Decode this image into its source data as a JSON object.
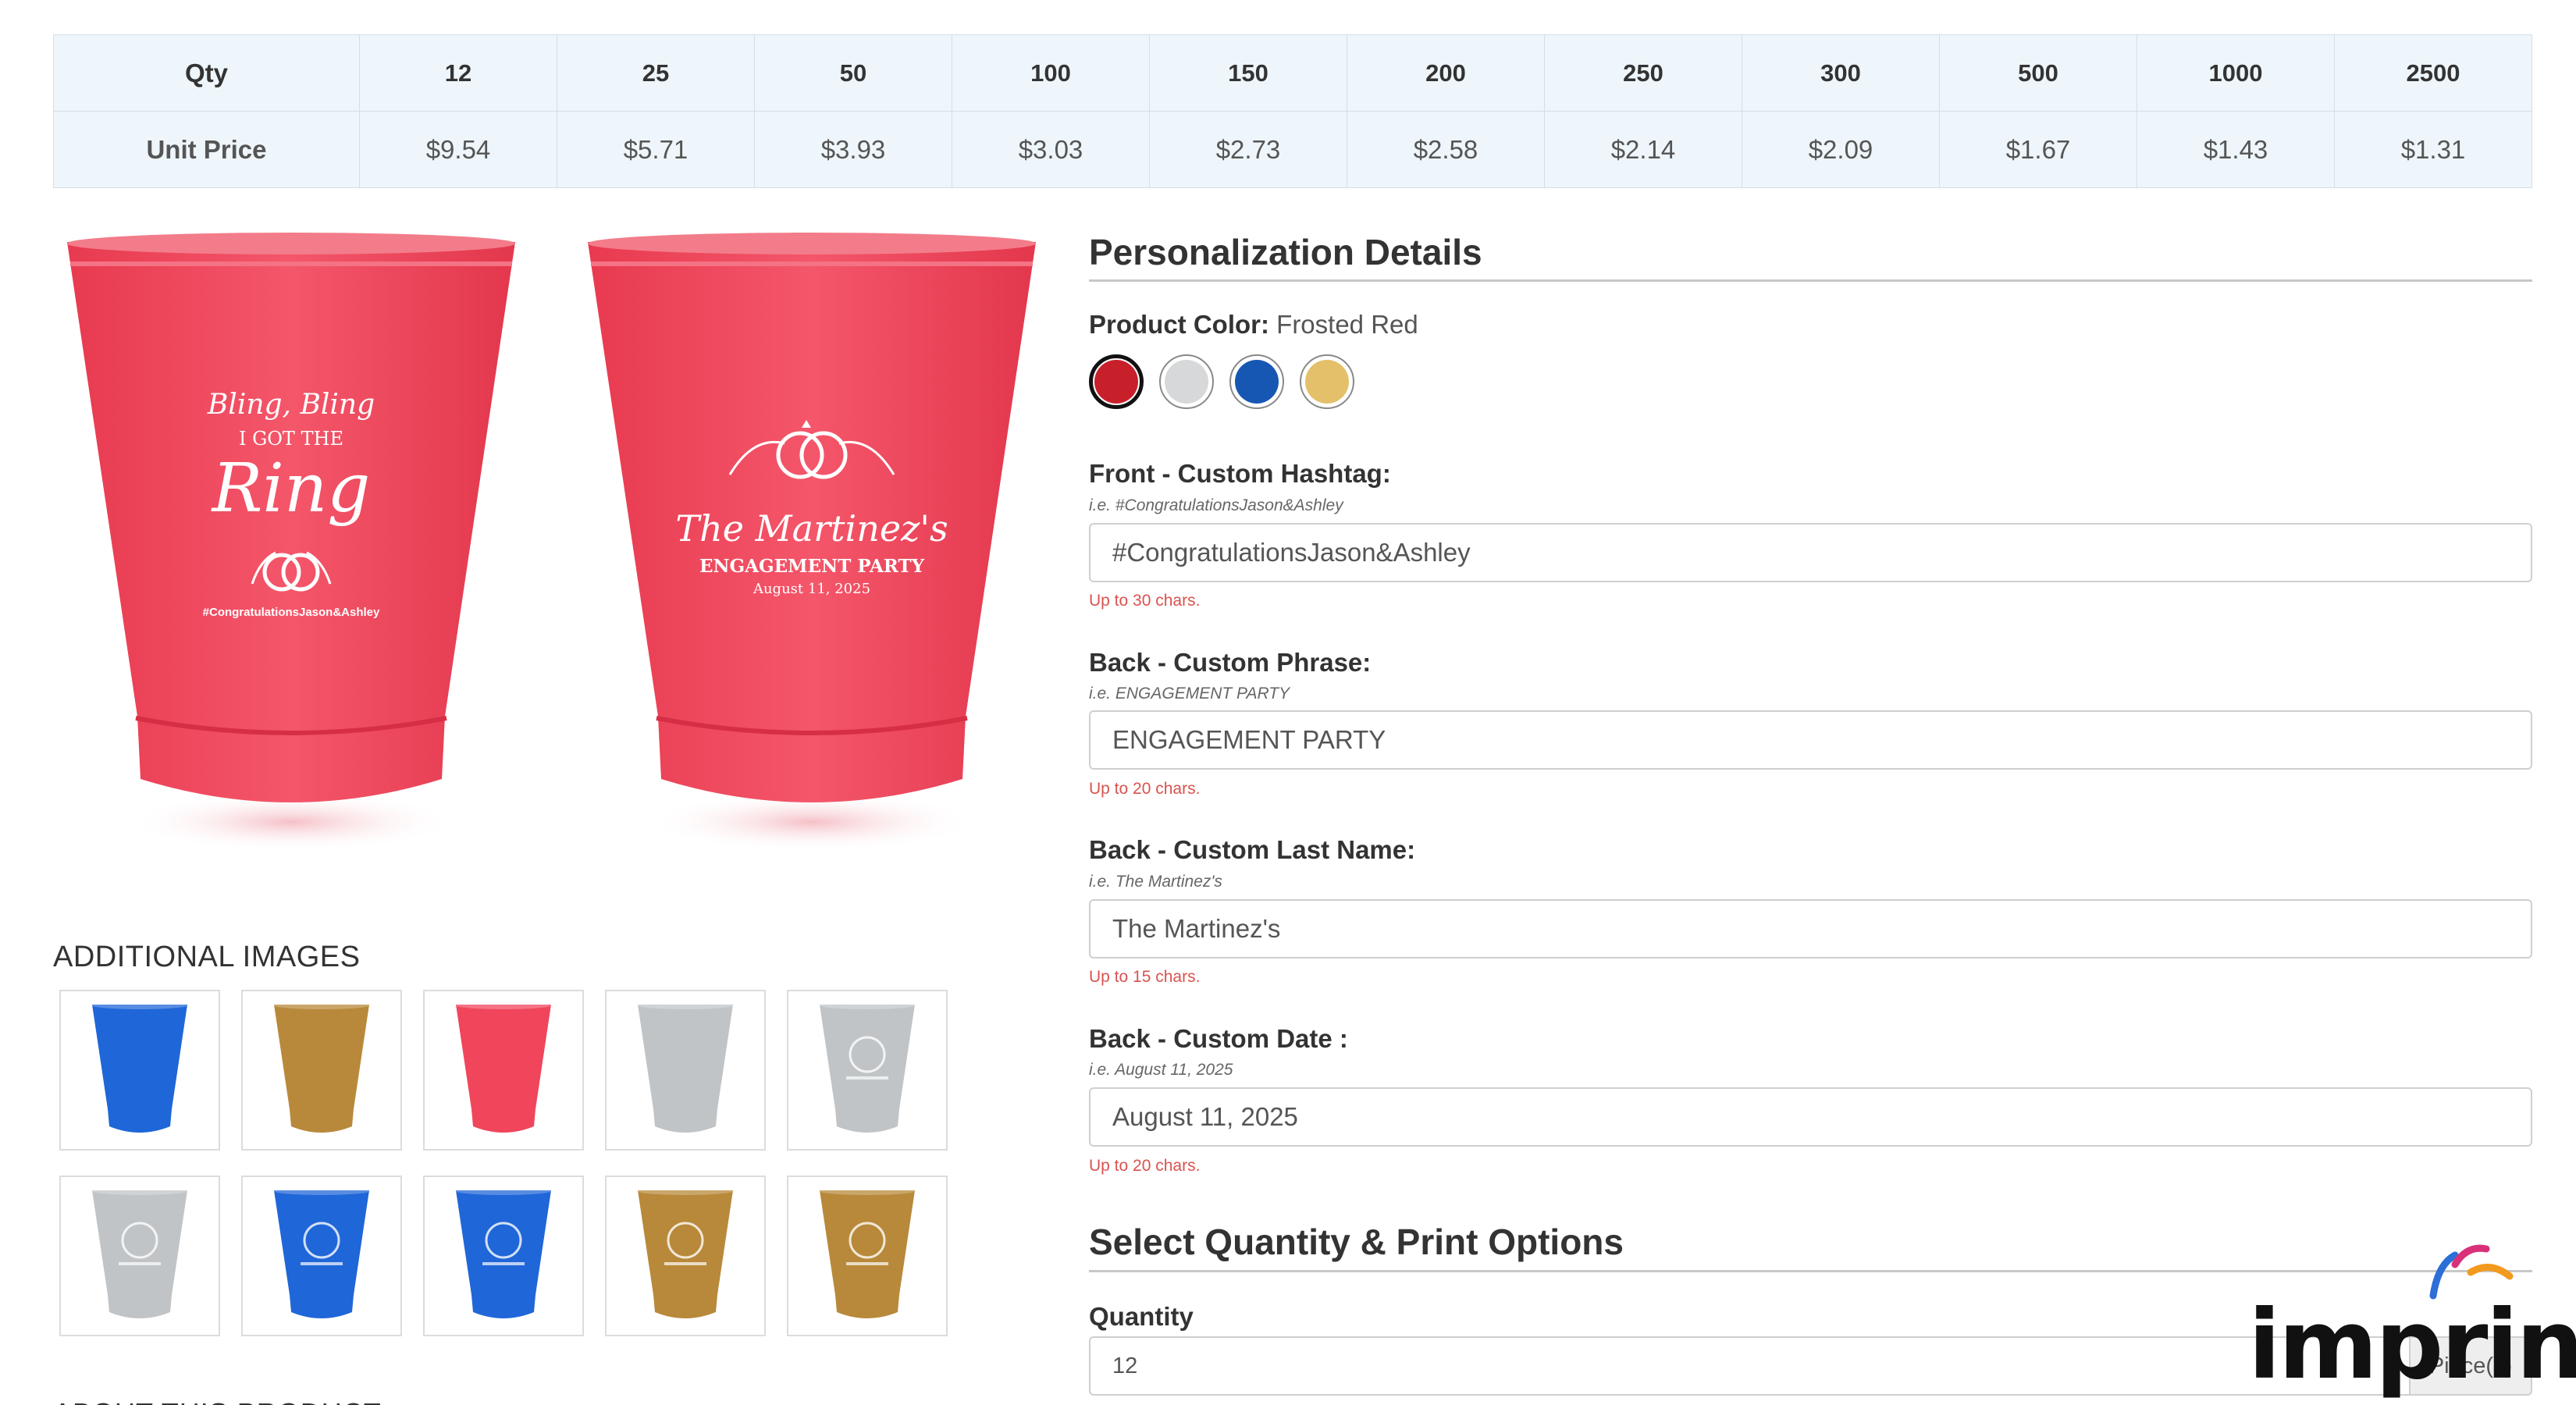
{
  "price_table": {
    "qty_label": "Qty",
    "price_label": "Unit Price",
    "quantities": [
      "12",
      "25",
      "50",
      "100",
      "150",
      "200",
      "250",
      "300",
      "500",
      "1000",
      "2500"
    ],
    "prices": [
      "$9.54",
      "$5.71",
      "$3.93",
      "$3.03",
      "$2.73",
      "$2.58",
      "$2.14",
      "$2.09",
      "$1.67",
      "$1.43",
      "$1.31"
    ]
  },
  "cup_front": {
    "line1": "Bling, Bling",
    "line2": "I GOT THE",
    "line3": "Ring",
    "hashtag": "#CongratulationsJason&Ashley",
    "color": "#f0455b"
  },
  "cup_back": {
    "name": "The Martinez's",
    "phrase": "ENGAGEMENT PARTY",
    "date": "August 11, 2025",
    "color": "#f0455b"
  },
  "additional_images": {
    "title": "ADDITIONAL IMAGES",
    "thumbs": [
      {
        "color": "#1f66d8",
        "printed": false,
        "icon": "blue-cup-icon"
      },
      {
        "color": "#b8893a",
        "printed": false,
        "icon": "gold-cup-icon"
      },
      {
        "color": "#f0455b",
        "printed": false,
        "icon": "red-cup-icon"
      },
      {
        "color": "#c0c4c7",
        "printed": false,
        "icon": "silver-cup-icon"
      },
      {
        "color": "#c0c4c7",
        "printed": true,
        "icon": "silver-cup-printed-icon"
      },
      {
        "color": "#c0c4c7",
        "printed": true,
        "icon": "silver-cup-printed-icon"
      },
      {
        "color": "#1f66d8",
        "printed": true,
        "icon": "blue-cup-printed-icon"
      },
      {
        "color": "#1f66d8",
        "printed": true,
        "icon": "blue-cup-printed-icon"
      },
      {
        "color": "#b8893a",
        "printed": true,
        "icon": "gold-cup-printed-icon"
      },
      {
        "color": "#b8893a",
        "printed": true,
        "icon": "gold-cup-printed-icon"
      }
    ]
  },
  "about_title": "ABOUT THIS PRODUCT",
  "personalization": {
    "title": "Personalization Details",
    "product_color_label": "Product Color:",
    "product_color_value": "Frosted Red",
    "swatches": [
      {
        "color": "#c8202b",
        "selected": true
      },
      {
        "color": "#d6d8d9",
        "selected": false
      },
      {
        "color": "#1757b4",
        "selected": false
      },
      {
        "color": "#e5c06a",
        "selected": false
      }
    ],
    "fields": [
      {
        "label": "Front - Custom Hashtag:",
        "hint": "i.e. #CongratulationsJason&Ashley",
        "value": "#CongratulationsJason&Ashley",
        "limit": "Up to 30 chars."
      },
      {
        "label": "Back - Custom Phrase:",
        "hint": "i.e. ENGAGEMENT PARTY",
        "value": "ENGAGEMENT PARTY",
        "limit": "Up to 20 chars."
      },
      {
        "label": "Back - Custom Last Name:",
        "hint": "i.e. The Martinez's",
        "value": "The Martinez's",
        "limit": "Up to 15 chars."
      },
      {
        "label": "Back - Custom Date :",
        "hint": "i.e. August 11, 2025",
        "value": "August 11, 2025",
        "limit": "Up to 20 chars."
      }
    ]
  },
  "quantity_section": {
    "title": "Select Quantity & Print Options",
    "quantity_label": "Quantity",
    "quantity_value": "12",
    "unit": "Piece(s)"
  },
  "logo": {
    "text": "imprint"
  }
}
